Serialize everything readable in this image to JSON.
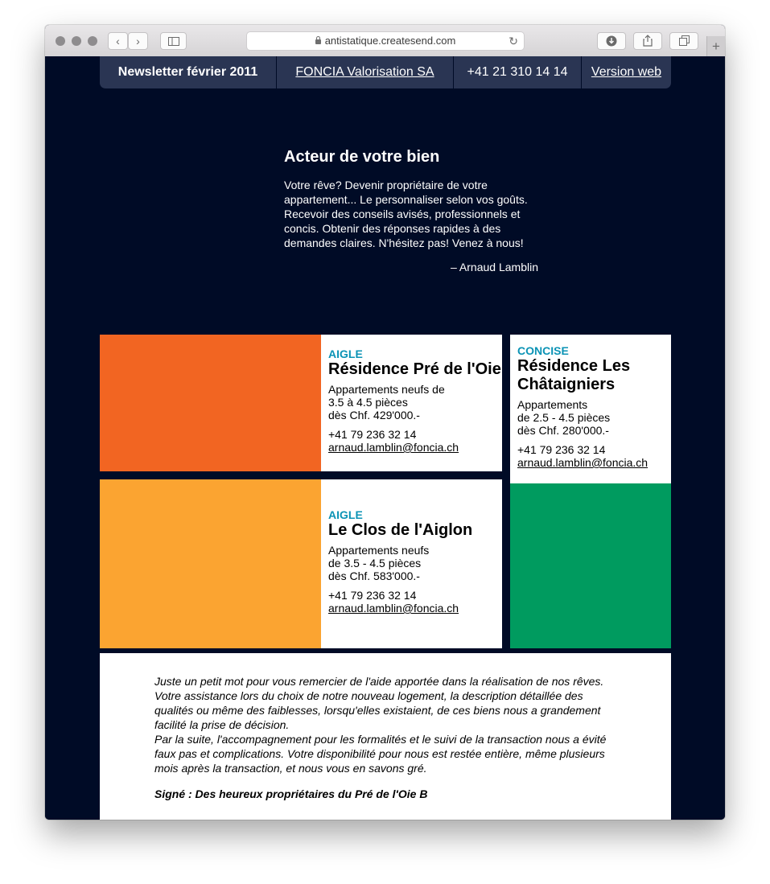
{
  "browser": {
    "url": "antistatique.createsend.com"
  },
  "topbar": {
    "newsletter": "Newsletter février 2011",
    "company": "FONCIA Valorisation SA",
    "phone": "+41 21 310 14 14",
    "web_version": "Version web"
  },
  "intro": {
    "title": "Acteur de votre bien",
    "body": "Votre rêve? Devenir propriétaire de votre appartement... Le personnaliser selon vos goûts. Recevoir des conseils avisés, professionnels et concis. Obtenir des réponses rapides à des demandes claires. N'hésitez pas! Venez à nous!",
    "author": "– Arnaud Lamblin"
  },
  "listings": [
    {
      "location": "AIGLE",
      "name": "Résidence Pré de l'Oie",
      "desc1": "Appartements neufs de",
      "desc2": "3.5 à 4.5 pièces",
      "price": "dès Chf. 429'000.-",
      "phone": "+41 79 236 32 14",
      "email": "arnaud.lamblin@foncia.ch",
      "color": "#f26522"
    },
    {
      "location": "CONCISE",
      "name": "Résidence Les Châtaigniers",
      "desc1": "Appartements",
      "desc2": "de 2.5 - 4.5 pièces",
      "price": "dès Chf. 280'000.-",
      "phone": "+41 79 236 32 14",
      "email": "arnaud.lamblin@foncia.ch",
      "color": "#009b5f"
    },
    {
      "location": "AIGLE",
      "name": "Le Clos de l'Aiglon",
      "desc1": "Appartements neufs",
      "desc2": "de 3.5 - 4.5 pièces",
      "price": "dès Chf. 583'000.-",
      "phone": "+41 79 236 32 14",
      "email": "arnaud.lamblin@foncia.ch",
      "color": "#fba431"
    }
  ],
  "testimonial": {
    "line1": "Juste un petit mot pour vous remercier de l'aide apportée dans la réalisation de nos rêves. Votre assistance lors du choix de notre nouveau logement, la description détaillée des qualités ou même des faiblesses, lorsqu'elles existaient, de ces biens nous a grandement facilité la prise de décision.",
    "line2": "Par la suite, l'accompagnement pour les formalités et le suivi de la transaction nous a évité faux pas et complications. Votre disponibilité pour nous est restée entière, même plusieurs mois après la transaction, et nous vous en savons gré.",
    "signature": "Signé : Des heureux propriétaires du Pré de l'Oie B"
  },
  "bottom_colors": [
    "#ffffff",
    "#0b93b5",
    "#ffffff"
  ]
}
